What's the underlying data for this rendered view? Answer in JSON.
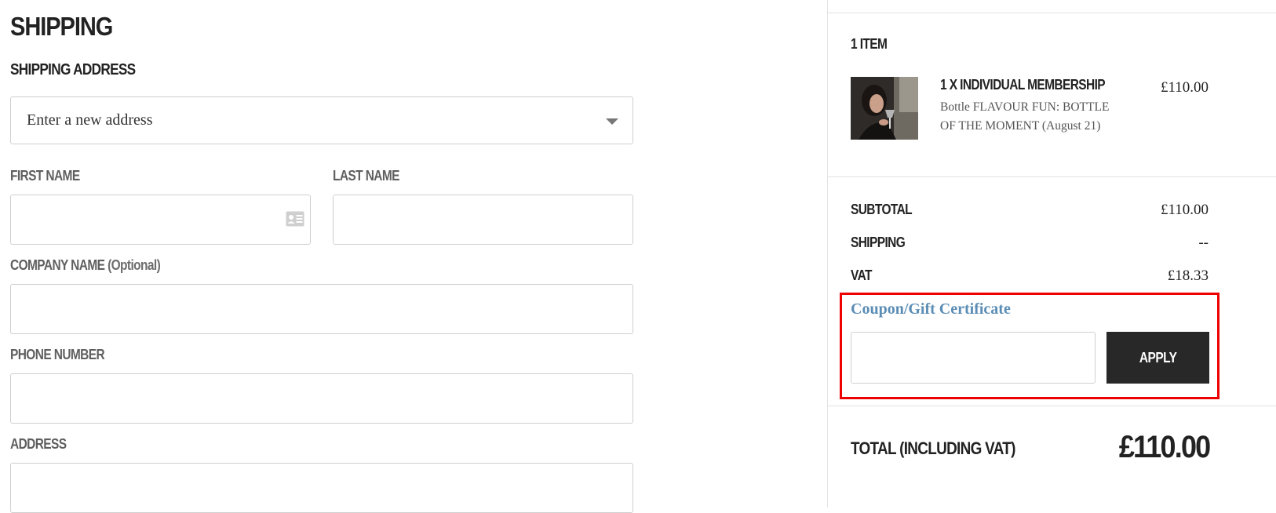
{
  "shipping": {
    "title": "SHIPPING",
    "section_title": "SHIPPING ADDRESS",
    "address_select_value": "Enter a new address",
    "labels": {
      "first_name": "FIRST NAME",
      "last_name": "LAST NAME",
      "company_name": "COMPANY NAME",
      "company_optional": "(Optional)",
      "phone_number": "PHONE NUMBER",
      "address": "ADDRESS"
    },
    "values": {
      "first_name": "",
      "last_name": "",
      "company_name": "",
      "phone_number": "",
      "address": ""
    }
  },
  "summary": {
    "item_count": "1 ITEM",
    "item": {
      "name": "1 X INDIVIDUAL MEMBERSHIP",
      "description": "Bottle FLAVOUR FUN: BOTTLE OF THE MOMENT (August 21)",
      "price": "£110.00",
      "image_icon": "product-photo-woman-wine-glass"
    },
    "rows": [
      {
        "label": "SUBTOTAL",
        "value": "£110.00"
      },
      {
        "label": "SHIPPING",
        "value": "--"
      },
      {
        "label": "VAT",
        "value": "£18.33"
      }
    ],
    "coupon": {
      "link_label": "Coupon/Gift Certificate",
      "input_value": "",
      "apply_label": "APPLY"
    },
    "total": {
      "label": "TOTAL (INCLUDING VAT)",
      "value": "£110.00"
    }
  },
  "colors": {
    "highlight": "#ee0000",
    "button_bg": "#282828",
    "link": "#5b8db5"
  }
}
